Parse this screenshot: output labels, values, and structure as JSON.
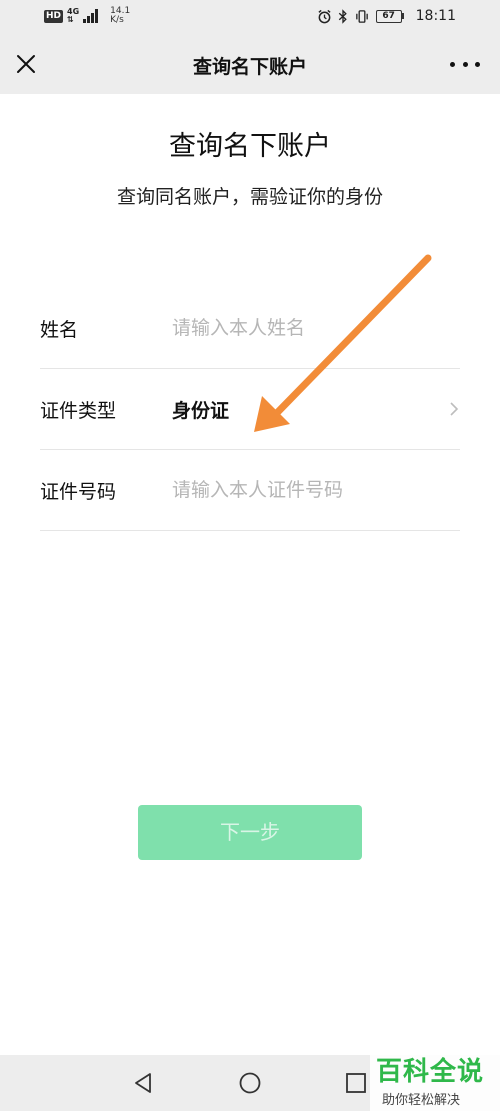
{
  "status_bar": {
    "hd": "HD",
    "net_type_top": "4G",
    "net_type_bottom": "⇅",
    "speed_value": "14.1",
    "speed_unit": "K/s",
    "battery": "67",
    "time": "18:11"
  },
  "header": {
    "title": "查询名下账户"
  },
  "main": {
    "heading": "查询名下账户",
    "subheading": "查询同名账户，需验证你的身份"
  },
  "form": {
    "name": {
      "label": "姓名",
      "placeholder": "请输入本人姓名"
    },
    "id_type": {
      "label": "证件类型",
      "value": "身份证"
    },
    "id_number": {
      "label": "证件号码",
      "placeholder": "请输入本人证件号码"
    }
  },
  "next_button": {
    "label": "下一步"
  },
  "watermark": {
    "title": "百科全说",
    "subtitle": "助你轻松解决"
  },
  "colors": {
    "accent": "#7fe0ac",
    "arrow": "#f28c38",
    "watermark": "#2fb84a"
  }
}
